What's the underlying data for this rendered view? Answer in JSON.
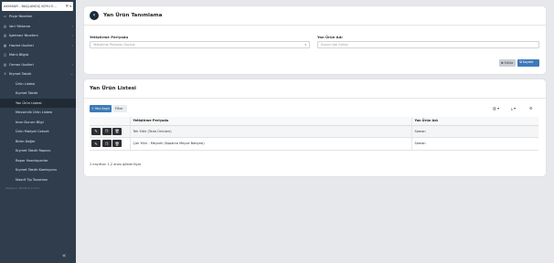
{
  "sidebar": {
    "farm_select": "AKHİSAR - BAŞLANGIÇ KÖYÜ E...",
    "farm_clear": "✕",
    "farm_caret": "▾",
    "items": [
      {
        "icon": "▭",
        "label": "Proje Yönetimi",
        "chev": ""
      },
      {
        "icon": "▤",
        "label": "Veri Yükleme",
        "chev": "‹"
      },
      {
        "icon": "▥",
        "label": "İşletmez Yönetimi",
        "chev": "‹"
      },
      {
        "icon": "▦",
        "label": "Hazine Usulleri",
        "chev": "‹"
      },
      {
        "icon": "◫",
        "label": "Mahlı Bilgisi",
        "chev": ""
      },
      {
        "icon": "▧",
        "label": "Orman Usulleri",
        "chev": "‹"
      },
      {
        "icon": "⊻",
        "label": "Kiymet Takdir",
        "chev": "⌄"
      }
    ],
    "subitems": [
      "Ürün Listesi",
      "Kıymet Takdir",
      "Yan Ürün Listesi",
      "Mevsimlik Ürün Listesi",
      "İmar Durum Bilgi",
      "Ürün Maliyet Cetveli",
      "Birim Değer",
      "Kıymet Takdir Raporu",
      "Rapor Hazırlayanlar",
      "Kıymet Takdir Komisyonu",
      "Maarif Tip Tanımları"
    ],
    "version": "Versiyon: 00.05.0.17.0.0",
    "collapse": "«"
  },
  "definition": {
    "title": "Yan Ürün Tanımlama",
    "back": "‹",
    "period_label": "Yetiştirme Periyodu",
    "period_placeholder": "Yetiştirme Periyodu Seçiniz",
    "period_caret": "▾",
    "name_label": "Yan Ürün Adı",
    "name_placeholder": "Durum Adı Giriniz",
    "clear_label": "✖ Sıfırla",
    "save_label": "🖫 Kaydet"
  },
  "list": {
    "title": "Yan Ürün Listesi",
    "new_label": "+ Yeni Kayıt",
    "filter_label": "Filtre",
    "tool_columns": "▥ ▾",
    "tool_export": "⤓ ▾",
    "tool_settings": "⚙",
    "columns": {
      "period": "Yetiştirme Periyodu",
      "name": "Yan Ürün Adı"
    },
    "action_icons": {
      "edit": "✎",
      "copy": "❐",
      "delete": "🗑"
    },
    "rows": [
      {
        "period": "Tek Yıllık (Tarla Ürünleri)",
        "name": "Saman"
      },
      {
        "period": "Çok Yıllık - Meyveli (Kapama Meyve Bahçesi)",
        "name": "Saman"
      }
    ],
    "pager": "2 kayıttan 1-2 arası gösteriliyor"
  }
}
